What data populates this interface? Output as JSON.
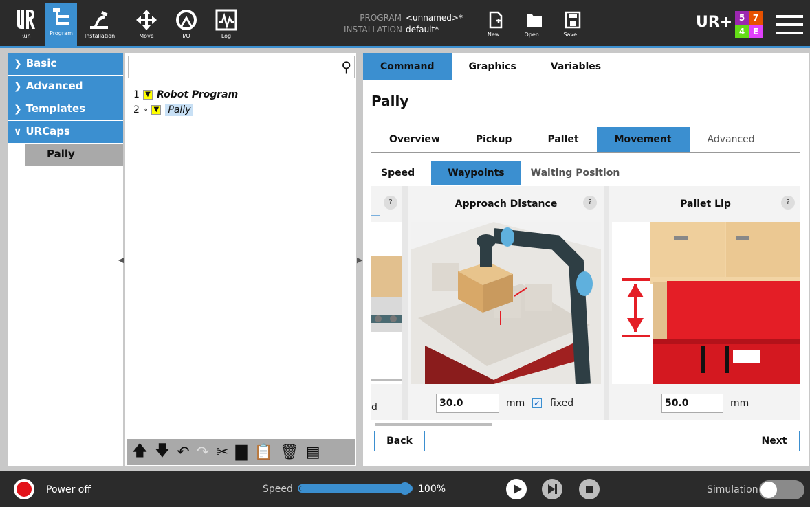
{
  "topbar": {
    "nav": [
      {
        "label": "Run",
        "icon": "ur-logo-icon"
      },
      {
        "label": "Program",
        "icon": "program-tree-icon",
        "active": true
      },
      {
        "label": "Installation",
        "icon": "robot-arm-icon"
      },
      {
        "label": "Move",
        "icon": "move-arrows-icon"
      },
      {
        "label": "I/O",
        "icon": "io-gauge-icon"
      },
      {
        "label": "Log",
        "icon": "log-pulse-icon"
      }
    ],
    "program_key": "PROGRAM",
    "program_value": "<unnamed>*",
    "installation_key": "INSTALLATION",
    "installation_value": "default*",
    "file_buttons": [
      {
        "label": "New...",
        "icon": "new-file-icon"
      },
      {
        "label": "Open...",
        "icon": "open-folder-icon"
      },
      {
        "label": "Save...",
        "icon": "save-disk-icon"
      }
    ],
    "urplus": "UR+",
    "kpi": [
      {
        "value": "5",
        "color": "#9c27b0"
      },
      {
        "value": "7",
        "color": "#e65100"
      },
      {
        "value": "4",
        "color": "#64dd17"
      },
      {
        "value": "E",
        "color": "#e040fb"
      }
    ]
  },
  "left": {
    "items": [
      {
        "label": "Basic",
        "expanded": false
      },
      {
        "label": "Advanced",
        "expanded": false
      },
      {
        "label": "Templates",
        "expanded": false
      },
      {
        "label": "URCaps",
        "expanded": true
      }
    ],
    "sub_item": "Pally"
  },
  "tree": {
    "rows": [
      {
        "num": "1",
        "label": "Robot Program"
      },
      {
        "num": "2",
        "label": "Pally"
      }
    ]
  },
  "right": {
    "tabs": [
      "Command",
      "Graphics",
      "Variables"
    ],
    "title": "Pally",
    "subtabs": [
      "Overview",
      "Pickup",
      "Pallet",
      "Movement",
      "Advanced"
    ],
    "subsubtabs": [
      "Speed",
      "Waypoints",
      "Waiting Position"
    ],
    "cards": {
      "help": "?",
      "approach": {
        "title": "Approach Distance",
        "value": "30.0",
        "unit": "mm",
        "fixed_label": "fixed",
        "fixed_checked": true
      },
      "lip": {
        "title": "Pallet Lip",
        "value": "50.0",
        "unit": "mm"
      },
      "partial_left_unit": "d"
    },
    "back": "Back",
    "next": "Next"
  },
  "bottom": {
    "power": "Power off",
    "speed_label": "Speed",
    "speed_value": "100%",
    "speed_fraction": 1.0,
    "simulation": "Simulation"
  }
}
